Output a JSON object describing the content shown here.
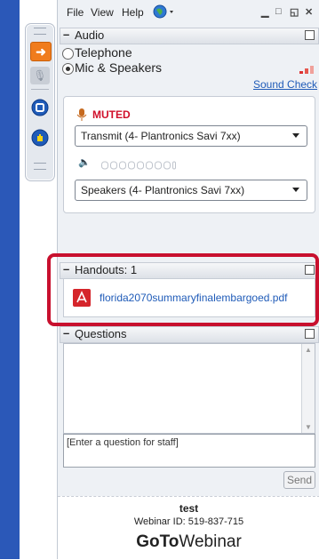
{
  "menu": {
    "file": "File",
    "view": "View",
    "help": "Help"
  },
  "audio": {
    "section_title": "Audio",
    "telephone": "Telephone",
    "mic_speakers": "Mic & Speakers",
    "sound_check": "Sound Check",
    "muted": "MUTED",
    "transmit": "Transmit (4- Plantronics Savi 7xx)",
    "speakers": "Speakers (4- Plantronics Savi 7xx)"
  },
  "handouts": {
    "section_title": "Handouts: 1",
    "file": "florida2070summaryfinalembargoed.pdf"
  },
  "questions": {
    "section_title": "Questions",
    "placeholder": "[Enter a question for staff]",
    "send": "Send"
  },
  "footer": {
    "name": "test",
    "webinar_id": "Webinar ID: 519-837-715",
    "brand_bold": "GoTo",
    "brand_light": "Webinar"
  },
  "colors": {
    "accent": "#1f5bb8",
    "muted": "#d0102b",
    "highlight": "#c8102e",
    "left_bar": "#2b58b8"
  }
}
